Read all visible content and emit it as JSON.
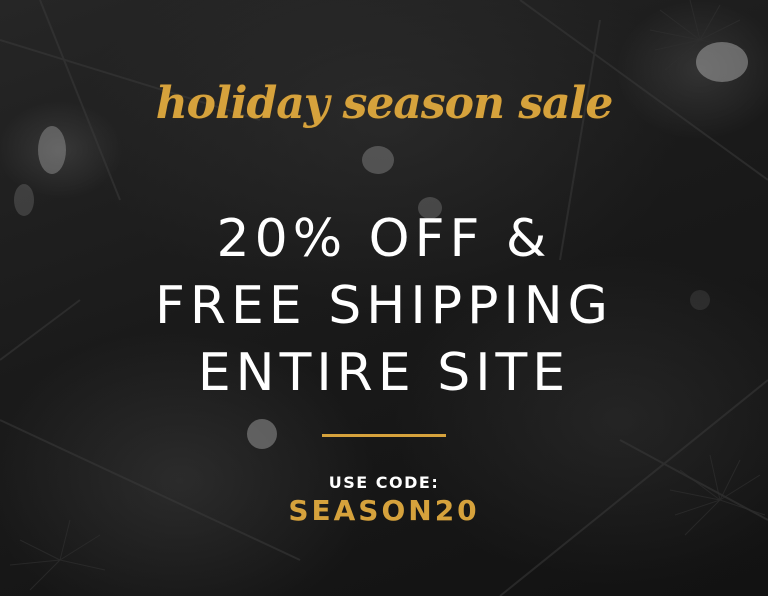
{
  "banner": {
    "script_title": "holiday season sale",
    "headline_lines": [
      "20% OFF &",
      "FREE SHIPPING",
      "ENTIRE SITE"
    ],
    "code_label": "USE CODE:",
    "code_value": "SEASON20"
  },
  "background": {
    "description_icon": "pine-branches-bokeh-lights-icon"
  },
  "colors": {
    "gold": "#d6a23c",
    "text": "#ffffff",
    "background": "#1a1a1a"
  }
}
